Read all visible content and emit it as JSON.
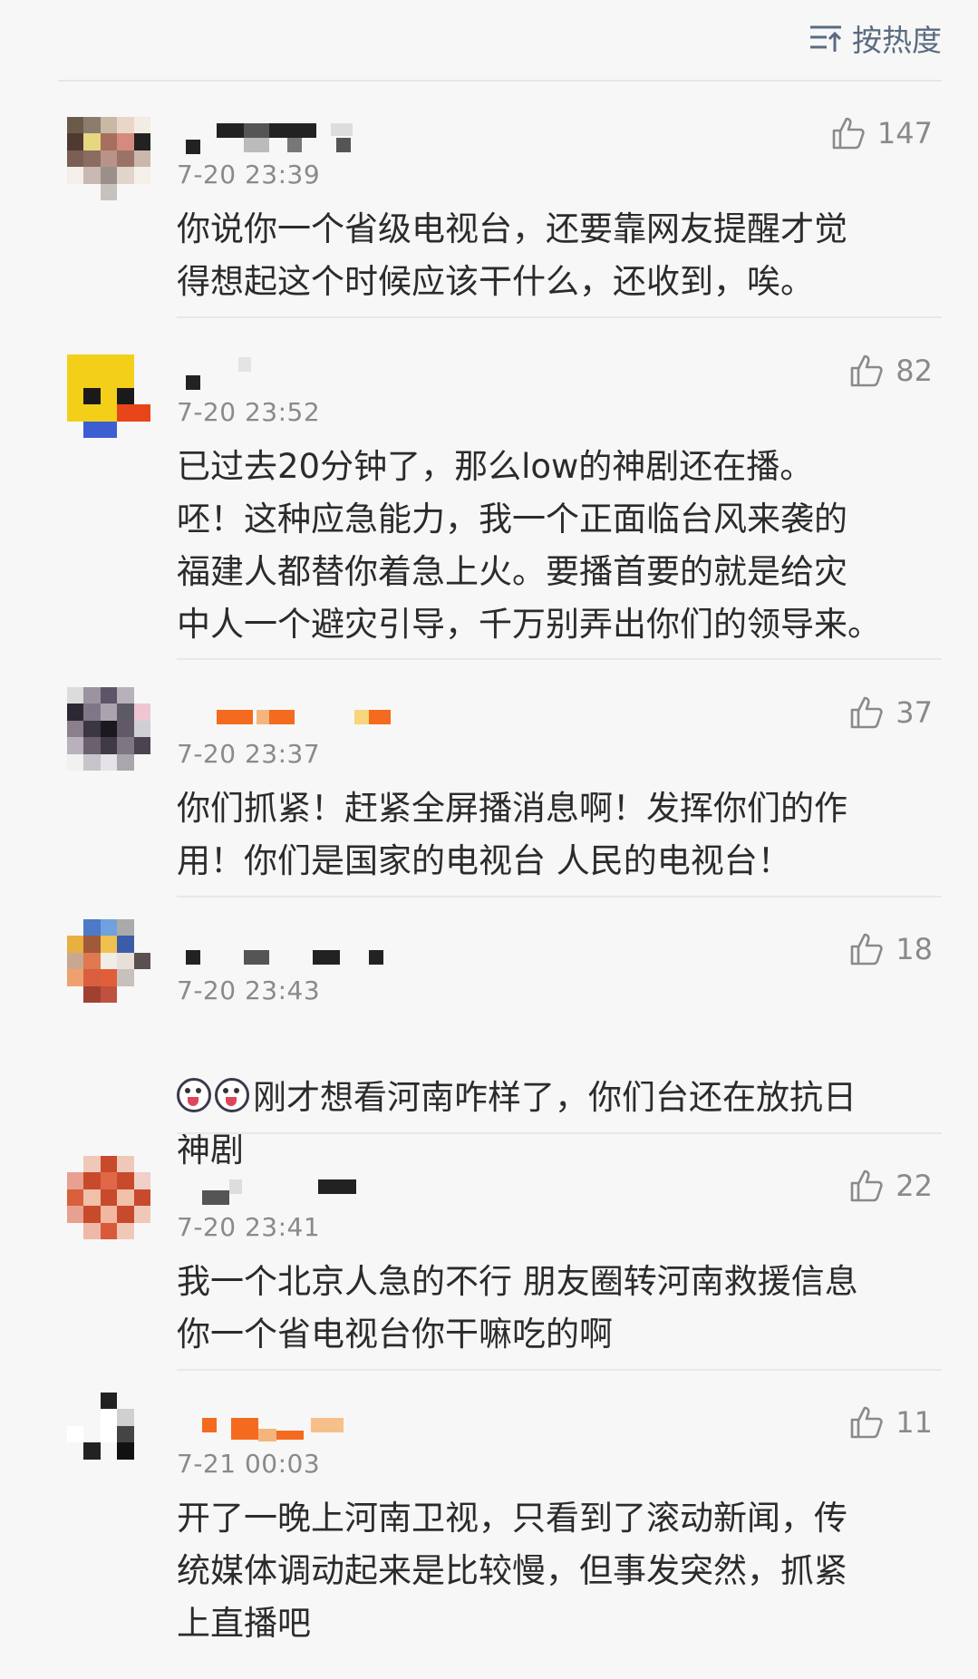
{
  "sort": {
    "label": "按热度",
    "icon": "sort-icon"
  },
  "comments": [
    {
      "time": "7-20 23:39",
      "likes": "147",
      "text": "你说你一个省级电视台，还要靠网友提醒才觉\n得想起这个时候应该干什么，还收到，唉。"
    },
    {
      "time": "7-20 23:52",
      "likes": "82",
      "text": "已过去20分钟了，那么low的神剧还在播。\n呸！这种应急能力，我一个正面临台风来袭的\n福建人都替你着急上火。要播首要的就是给灾\n中人一个避灾引导，千万别弄出你们的领导来。"
    },
    {
      "time": "7-20 23:37",
      "likes": "37",
      "text": "你们抓紧！赶紧全屏播消息啊！发挥你们的作\n用！你们是国家的电视台 人民的电视台！"
    },
    {
      "time": "7-20 23:43",
      "likes": "18",
      "text": "刚才想看河南咋样了，你们台还在放抗日\n神剧"
    },
    {
      "time": "7-20 23:41",
      "likes": "22",
      "text": "我一个北京人急的不行 朋友圈转河南救援信息\n你一个省电视台你干嘛吃的啊"
    },
    {
      "time": "7-21 00:03",
      "likes": "11",
      "text": "开了一晚上河南卫视，只看到了滚动新闻，传\n统媒体调动起来是比较慢，但事发突然，抓紧\n上直播吧"
    }
  ],
  "colors": {
    "accent": "#5a6b80",
    "meta": "#8a8a8a",
    "body_text": "#2b2b2b",
    "background": "#f7f7f7"
  }
}
